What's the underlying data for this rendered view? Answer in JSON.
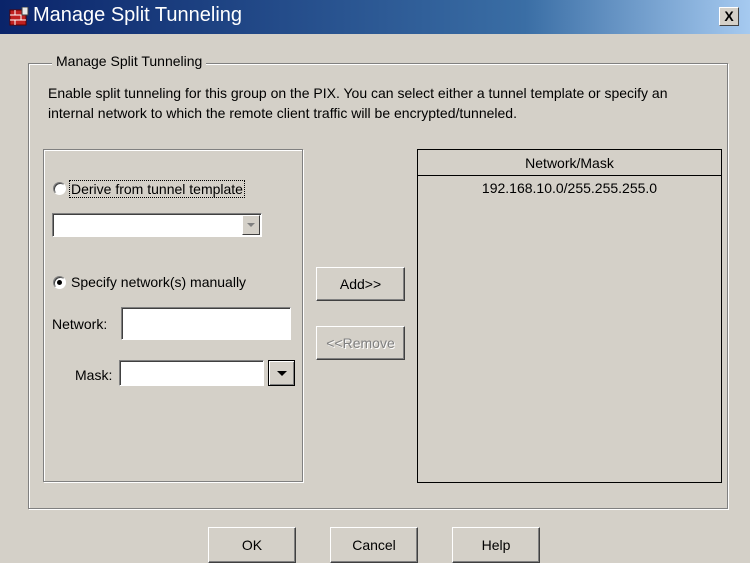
{
  "window": {
    "title": "Manage Split Tunneling",
    "close_label": "X"
  },
  "group": {
    "legend": "Manage Split Tunneling",
    "description": "Enable split tunneling for this group on the PIX. You can select either a tunnel template or specify an internal network to which the remote client traffic will be encrypted/tunneled."
  },
  "left_panel": {
    "derive_label": "Derive from tunnel template",
    "derive_selected": false,
    "template_value": "",
    "manual_label": "Specify network(s) manually",
    "manual_selected": true,
    "network_label": "Network:",
    "network_value": "",
    "mask_label": "Mask:",
    "mask_value": ""
  },
  "middle_buttons": {
    "add_label": "Add>>",
    "remove_label": "<<Remove",
    "remove_enabled": false
  },
  "network_list": {
    "header": "Network/Mask",
    "rows": [
      "192.168.10.0/255.255.255.0"
    ]
  },
  "footer": {
    "ok_label": "OK",
    "cancel_label": "Cancel",
    "help_label": "Help"
  },
  "icons": {
    "app": "pix-firewall-icon",
    "dropdown": "chevron-down-icon",
    "close": "close-icon"
  },
  "colors": {
    "titlebar_start": "#0a246a",
    "titlebar_end": "#a6caf0",
    "dialog_bg": "#d4d0c8",
    "disabled_text": "#808080"
  }
}
